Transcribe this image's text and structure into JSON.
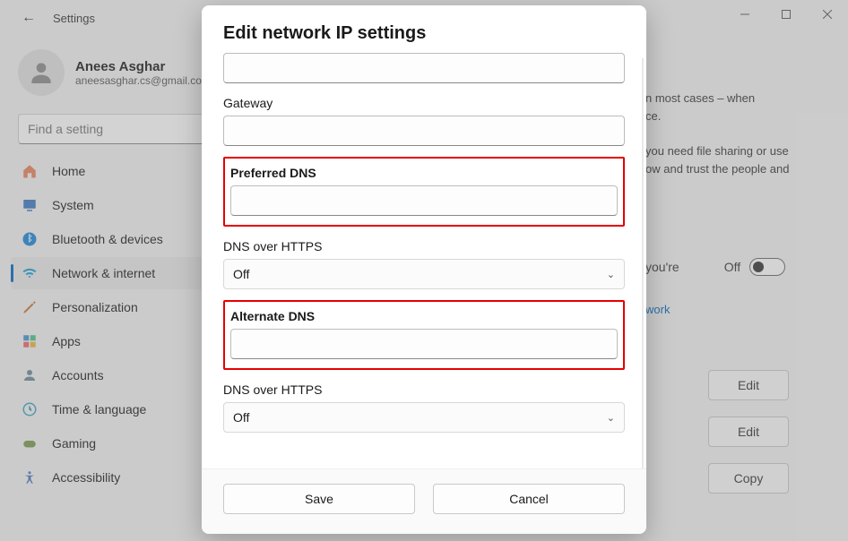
{
  "window": {
    "title": "Settings",
    "minimize_tip": "Minimize",
    "maximize_tip": "Maximize",
    "close_tip": "Close"
  },
  "user": {
    "name": "Anees Asghar",
    "email": "aneesasghar.cs@gmail.co"
  },
  "search": {
    "placeholder": "Find a setting"
  },
  "sidebar": {
    "items": [
      {
        "label": "Home",
        "icon": "home"
      },
      {
        "label": "System",
        "icon": "system"
      },
      {
        "label": "Bluetooth & devices",
        "icon": "bluetooth"
      },
      {
        "label": "Network & internet",
        "icon": "network",
        "selected": true
      },
      {
        "label": "Personalization",
        "icon": "personalization"
      },
      {
        "label": "Apps",
        "icon": "apps"
      },
      {
        "label": "Accounts",
        "icon": "accounts"
      },
      {
        "label": "Time & language",
        "icon": "time"
      },
      {
        "label": "Gaming",
        "icon": "gaming"
      },
      {
        "label": "Accessibility",
        "icon": "accessibility"
      }
    ]
  },
  "background": {
    "snippet1a": "n most cases – when",
    "snippet1b": "ce.",
    "snippet2a": "you need file sharing or use",
    "snippet2b": "ow and trust the people and",
    "metered_partial": "you're",
    "metered_value": "Off",
    "link_partial": "work",
    "edit_label": "Edit",
    "copy_label": "Copy"
  },
  "modal": {
    "title": "Edit network IP settings",
    "gateway_label": "Gateway",
    "gateway_value": "",
    "preferred_dns_label": "Preferred DNS",
    "preferred_dns_value": "",
    "doh1_label": "DNS over HTTPS",
    "doh1_value": "Off",
    "alternate_dns_label": "Alternate DNS",
    "alternate_dns_value": "",
    "doh2_label": "DNS over HTTPS",
    "doh2_value": "Off",
    "save_label": "Save",
    "cancel_label": "Cancel"
  }
}
